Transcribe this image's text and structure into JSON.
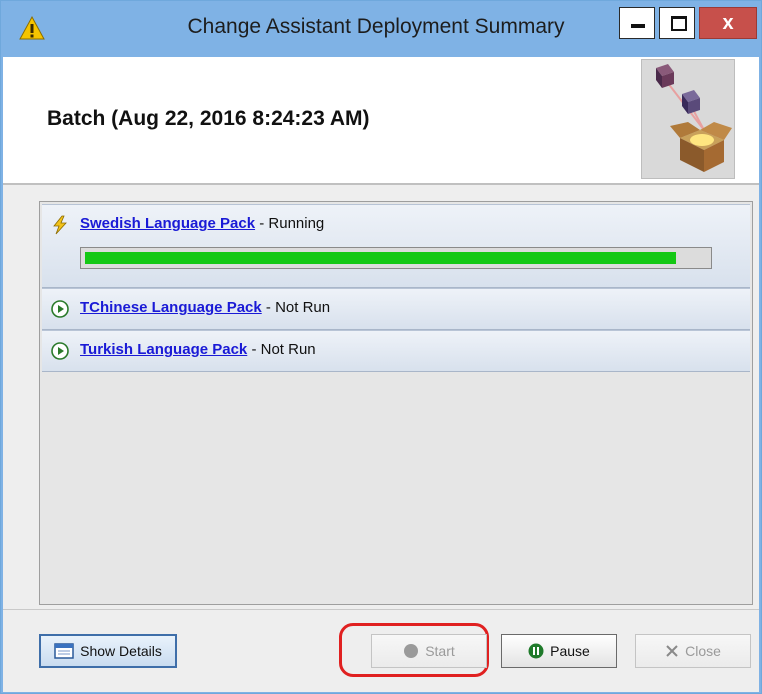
{
  "window": {
    "title": "Change Assistant Deployment Summary",
    "close_glyph": "x"
  },
  "header": {
    "batch_title": "Batch (Aug 22, 2016 8:24:23 AM)",
    "image_icon": "deployment-boxes-icon"
  },
  "steps": [
    {
      "name": "Swedish Language Pack",
      "status": " - Running",
      "icon": "lightning-icon",
      "progress_percent": 95
    },
    {
      "name": "TChinese Language Pack",
      "status": " - Not Run",
      "icon": "play-circle-icon"
    },
    {
      "name": "Turkish Language Pack",
      "status": " - Not Run",
      "icon": "play-circle-icon"
    }
  ],
  "buttons": {
    "show_details": "Show Details",
    "start": "Start",
    "pause": "Pause",
    "close": "Close"
  },
  "colors": {
    "titlebar": "#7fb2e5",
    "progress": "#14c814",
    "link": "#1a1ad6",
    "highlight": "#e02020"
  }
}
